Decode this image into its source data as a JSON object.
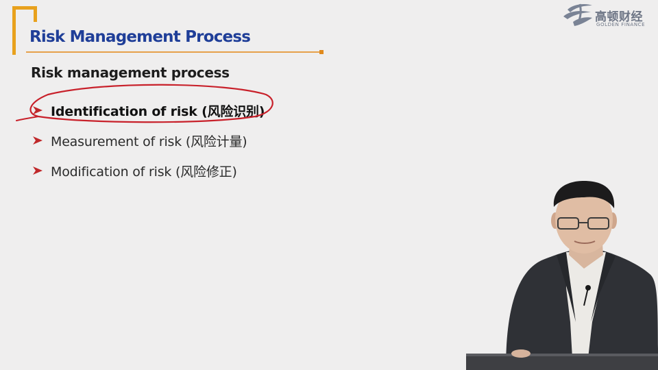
{
  "slide": {
    "title": "Risk Management Process",
    "subheading": "Risk management process",
    "bullets": [
      {
        "text": "Identification of risk (风险识别)",
        "emphasized": true,
        "circled": true
      },
      {
        "text": "Measurement of risk (风险计量)",
        "emphasized": false,
        "circled": false
      },
      {
        "text": "Modification of risk (风险修正)",
        "emphasized": false,
        "circled": false
      }
    ]
  },
  "logo": {
    "chinese_name": "高顿财经",
    "english_name": "GOLDEN FINANCE"
  },
  "colors": {
    "background": "#efeeee",
    "title_blue": "#1f3e98",
    "accent_orange": "#e8a11d",
    "bullet_arrow_red": "#c0282a",
    "annotation_red": "#c8202a",
    "logo_gray": "#6d7585"
  },
  "icons": {
    "bullet": "arrowhead-bullet-icon",
    "logo": "golden-finance-logo-icon"
  }
}
